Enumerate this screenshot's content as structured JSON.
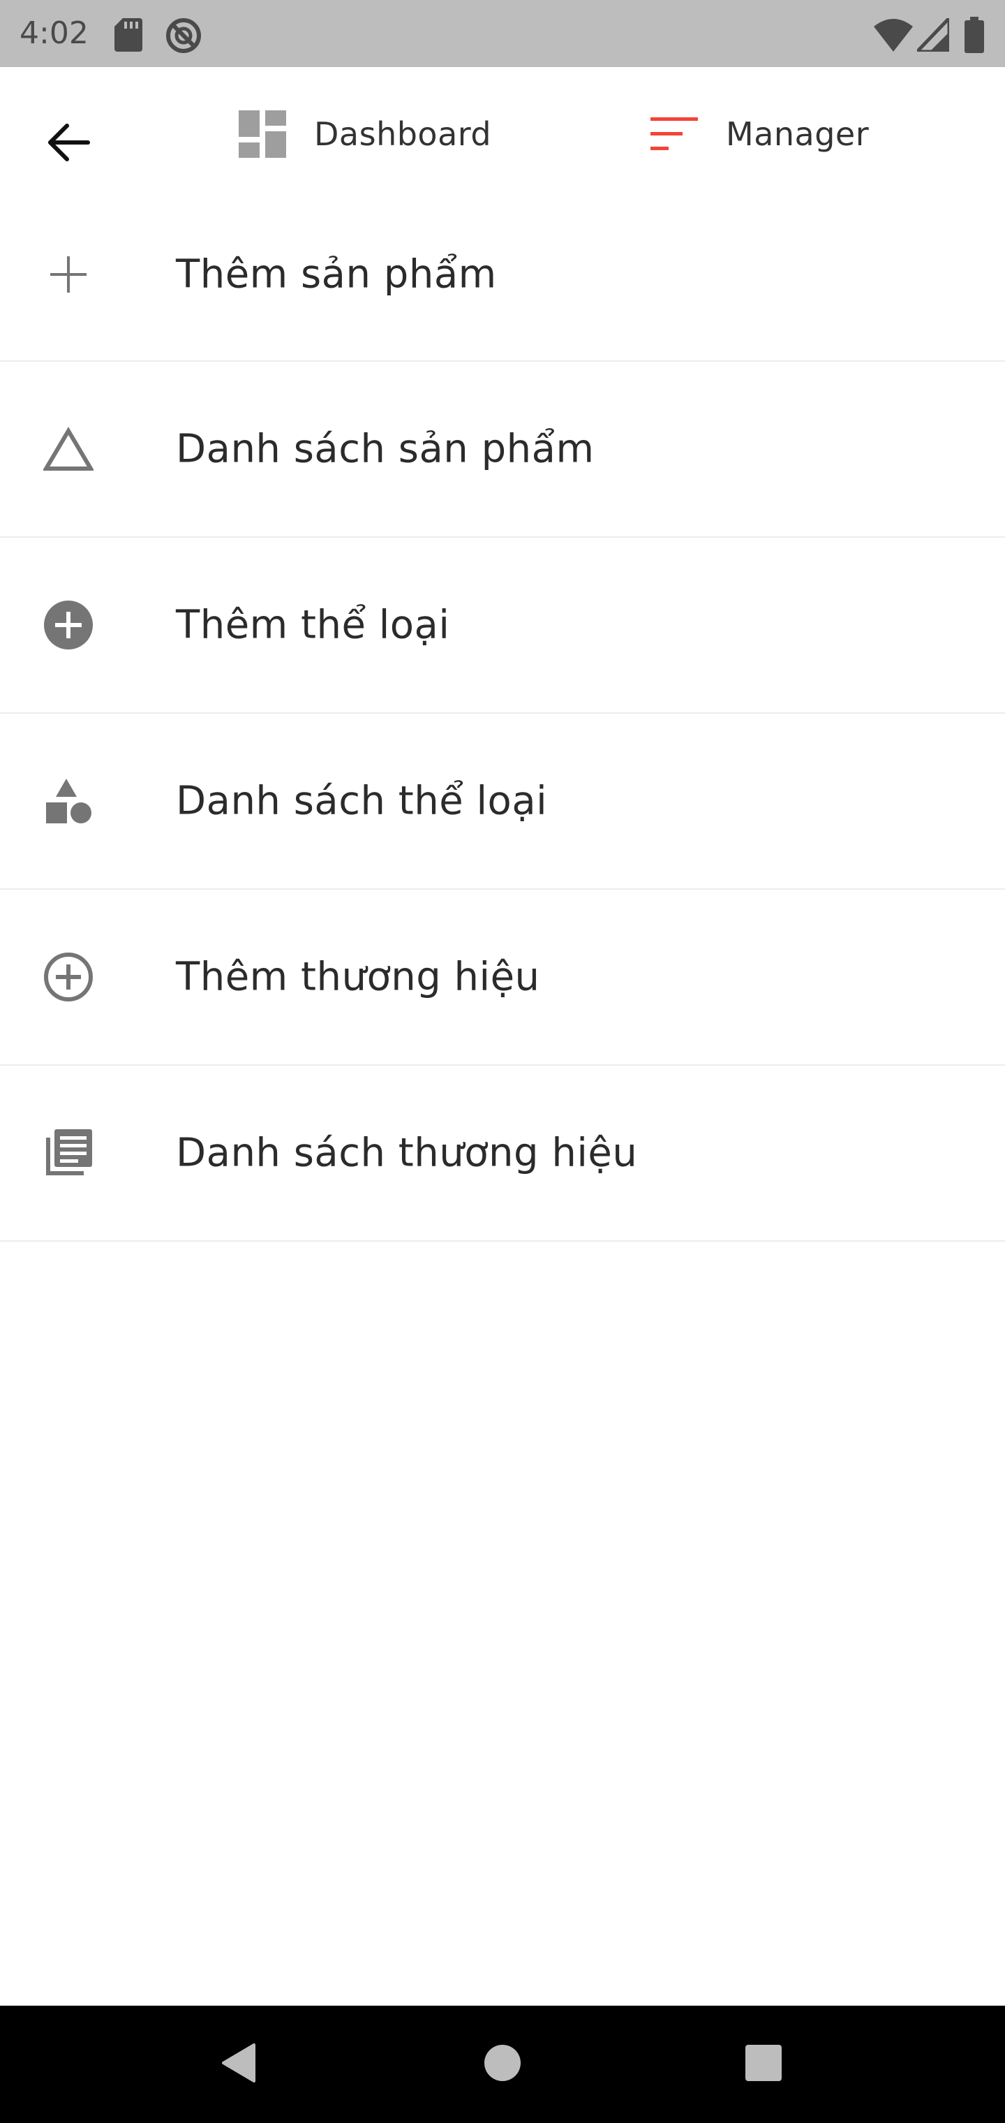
{
  "status_bar": {
    "time": "4:02",
    "icons": [
      "sd-card-icon",
      "sync-disabled-icon",
      "wifi-icon",
      "signal-icon",
      "battery-icon"
    ]
  },
  "app_bar": {
    "back_icon": "arrow-back-icon",
    "tabs": [
      {
        "label": "Dashboard",
        "icon": "dashboard-icon",
        "icon_color": "#9e9e9e"
      },
      {
        "label": "Manager",
        "icon": "sort-lines-icon",
        "icon_color": "#f44336"
      }
    ]
  },
  "menu": {
    "items": [
      {
        "label": "Thêm sản phẩm",
        "icon": "plus-icon"
      },
      {
        "label": "Danh sách sản phẩm",
        "icon": "triangle-outline-icon"
      },
      {
        "label": "Thêm thể loại",
        "icon": "add-circle-filled-icon"
      },
      {
        "label": "Danh sách thể loại",
        "icon": "category-shapes-icon"
      },
      {
        "label": "Thêm thương hiệu",
        "icon": "add-circle-outline-icon"
      },
      {
        "label": "Danh sách thương hiệu",
        "icon": "library-books-icon"
      }
    ],
    "icon_color": "#757575"
  },
  "nav_bar": {
    "buttons": [
      "back-triangle-icon",
      "home-circle-icon",
      "recents-square-icon"
    ]
  }
}
